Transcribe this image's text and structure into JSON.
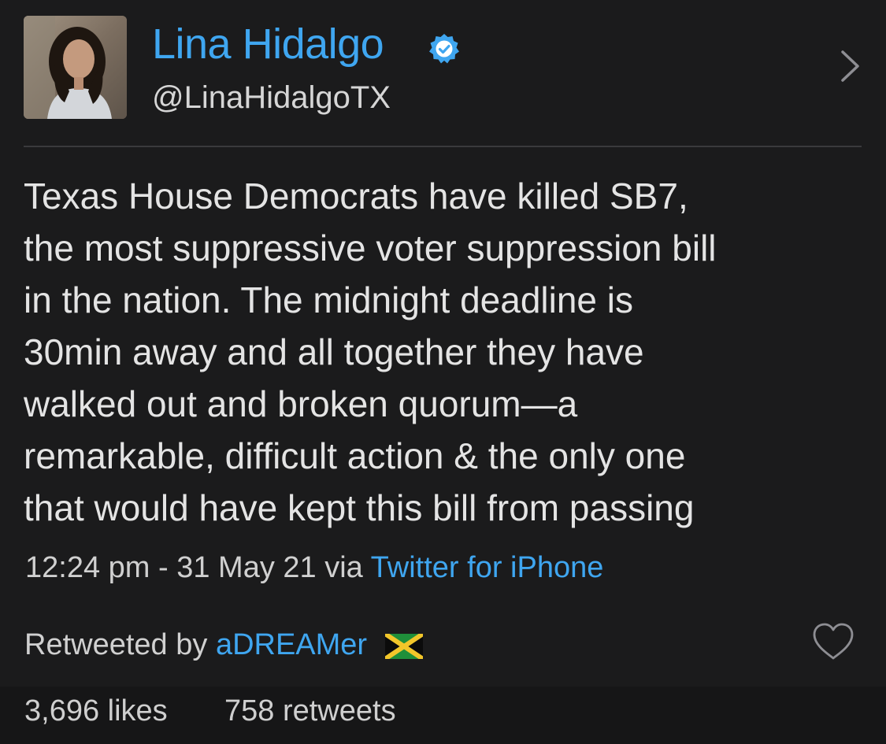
{
  "profile": {
    "display_name": "Lina Hidalgo",
    "handle": "@LinaHidalgoTX",
    "verified_icon": "verified-badge-icon",
    "avatar_icon": "profile-photo"
  },
  "tweet": {
    "text": "Texas House Democrats have killed SB7,\nthe most suppressive voter suppression bill\nin the nation. The midnight deadline is\n30min away and all together they have\nwalked out and broken quorum—a\nremarkable, difficult action & the only one\nthat would have kept this bill from passing",
    "timestamp": "12:24 pm - 31 May 21",
    "via_label": "via",
    "source": "Twitter for iPhone"
  },
  "retweet": {
    "label": "Retweeted by",
    "user": "aDREAMer",
    "flag_icon": "jamaica-flag-icon"
  },
  "stats": {
    "likes": "3,696 likes",
    "retweets": "758 retweets"
  },
  "colors": {
    "background": "#1b1b1c",
    "accent": "#3fa6f0",
    "text": "#e4e4e4"
  }
}
